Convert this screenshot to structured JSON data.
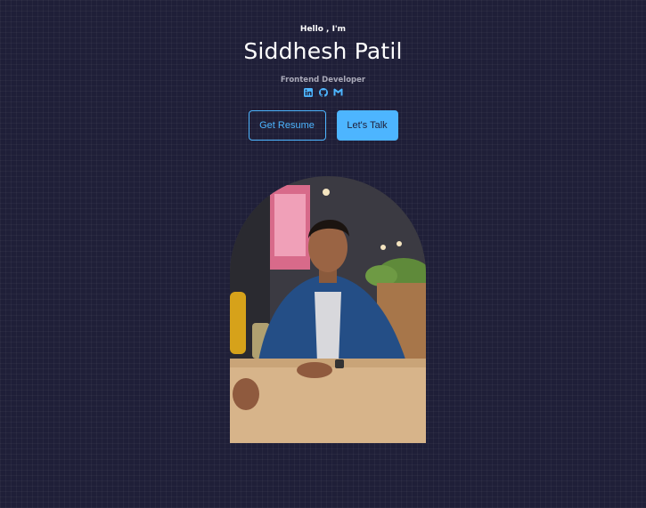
{
  "header": {
    "greeting": "Hello , I'm",
    "name": "Siddhesh Patil",
    "role": "Frontend Developer"
  },
  "socials": [
    {
      "icon": "linkedin-icon"
    },
    {
      "icon": "github-icon"
    },
    {
      "icon": "gmail-icon"
    }
  ],
  "cta": {
    "resume_label": "Get Resume",
    "talk_label": "Let's Talk"
  },
  "colors": {
    "background": "#1f1f38",
    "accent": "#4db5ff",
    "muted_text": "#a9a9b8"
  }
}
